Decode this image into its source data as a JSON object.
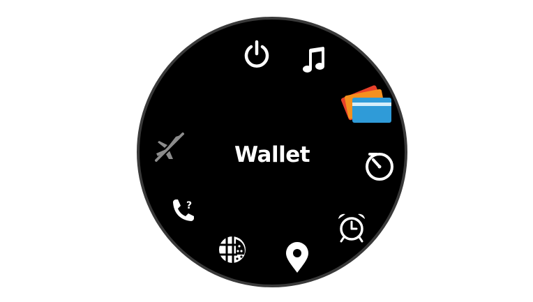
{
  "controls_menu": {
    "selected_label": "Wallet",
    "selected_item": "wallet",
    "items": [
      {
        "id": "power",
        "icon": "power-icon"
      },
      {
        "id": "music",
        "icon": "music-note-icon"
      },
      {
        "id": "wallet",
        "icon": "wallet-cards-icon",
        "selected": true
      },
      {
        "id": "stopwatch",
        "icon": "stopwatch-icon"
      },
      {
        "id": "alarm-clock",
        "icon": "alarm-clock-icon"
      },
      {
        "id": "save-location",
        "icon": "map-pin-icon"
      },
      {
        "id": "time-zones",
        "icon": "globe-clock-icon"
      },
      {
        "id": "find-my-phone",
        "icon": "phone-question-icon"
      },
      {
        "id": "airplane-mode",
        "icon": "airplane-mode-off-icon",
        "disabled": true
      }
    ]
  },
  "colors": {
    "face": "#000000",
    "bezel": "#3a3a3a",
    "icon": "#ffffff",
    "icon_disabled": "#8c8c8c",
    "wallet_card_red": "#e8412a",
    "wallet_card_orange": "#f5901e",
    "wallet_card_blue": "#2f9bd8"
  }
}
